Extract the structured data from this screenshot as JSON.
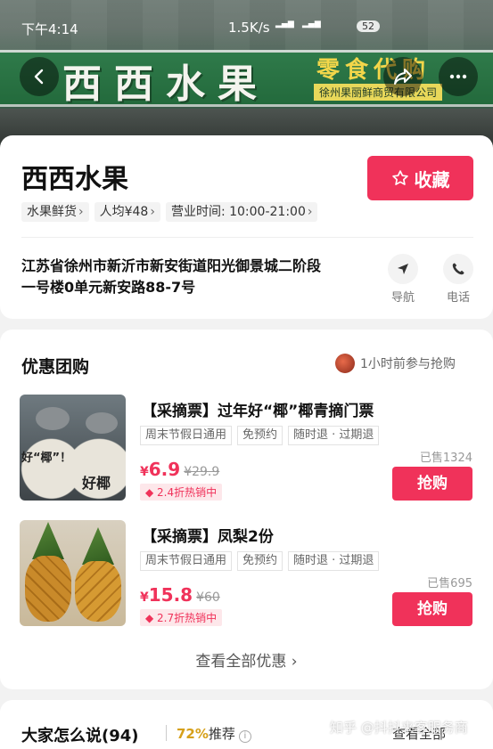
{
  "status_bar": {
    "time": "下午4:14",
    "network_speed": "1.5K/s",
    "battery": "52"
  },
  "store": {
    "sign_title": "西西水果",
    "sign_subtitle": "零食代购",
    "sign_company": "徐州果丽鲜商贸有限公司",
    "name": "西西水果",
    "favorite_label": "收藏",
    "tags": [
      "水果鲜货",
      "人均¥48",
      "营业时间: 10:00-21:00"
    ],
    "address": "江苏省徐州市新沂市新安街道阳光御景城二阶段一号楼0单元新安路88-7号",
    "actions": {
      "navigate": "导航",
      "call": "电话"
    }
  },
  "deals": {
    "title": "优惠团购",
    "recent_activity": "1小时前参与抢购",
    "items": [
      {
        "title": "【采摘票】过年好“椰”椰青摘门票",
        "tags": [
          "周末节假日通用",
          "免预约",
          "随时退 · 过期退"
        ],
        "price_symbol": "¥",
        "price": "6.9",
        "original_price": "¥29.9",
        "discount": "2.4折热销中",
        "sold": "已售1324",
        "thumb_text_1": "好“椰”！",
        "thumb_text_2": "好椰",
        "buy_label": "抢购"
      },
      {
        "title": "【采摘票】凤梨2份",
        "tags": [
          "周末节假日通用",
          "免预约",
          "随时退 · 过期退"
        ],
        "price_symbol": "¥",
        "price": "15.8",
        "original_price": "¥60",
        "discount": "2.7折热销中",
        "sold": "已售695",
        "buy_label": "抢购"
      }
    ],
    "view_all": "查看全部优惠"
  },
  "reviews": {
    "title": "大家怎么说(94)",
    "recommend_pct": "72%",
    "recommend_label": "推荐",
    "see_all": "查看全部",
    "watermark": "知乎 @抖抖来客服务商"
  },
  "colors": {
    "accent": "#f0325a",
    "recommend": "#d6a01a"
  }
}
